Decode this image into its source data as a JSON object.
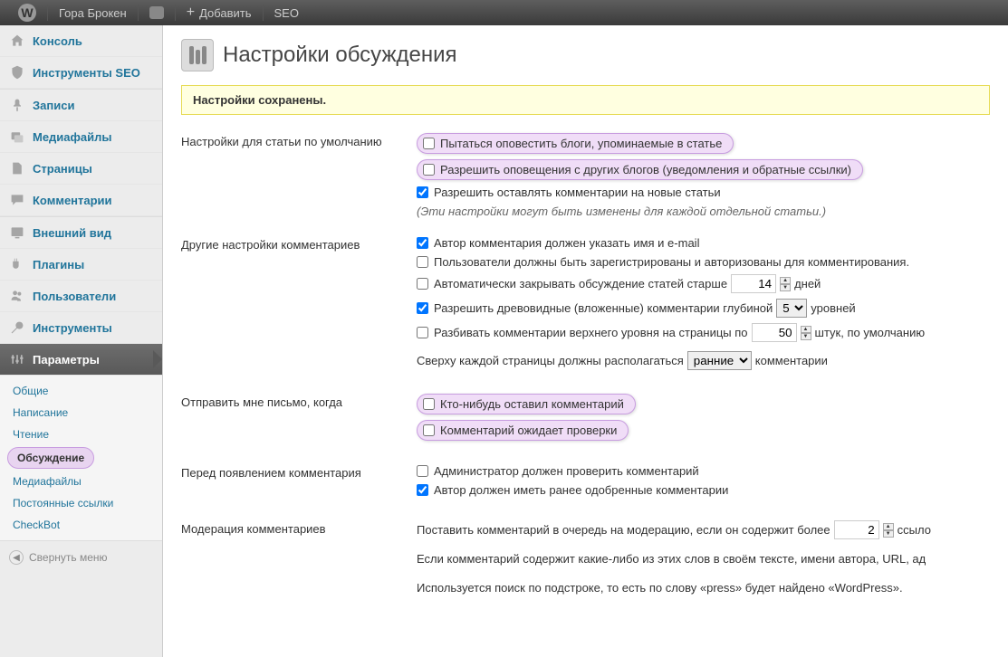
{
  "topbar": {
    "site_name": "Гора Брокен",
    "add_new": "Добавить",
    "seo": "SEO"
  },
  "sidebar": {
    "console": "Консоль",
    "seo_tools": "Инструменты SEO",
    "posts": "Записи",
    "media": "Медиафайлы",
    "pages": "Страницы",
    "comments": "Комментарии",
    "appearance": "Внешний вид",
    "plugins": "Плагины",
    "users": "Пользователи",
    "tools": "Инструменты",
    "settings": "Параметры",
    "submenu": {
      "general": "Общие",
      "writing": "Написание",
      "reading": "Чтение",
      "discussion": "Обсуждение",
      "media": "Медиафайлы",
      "permalinks": "Постоянные ссылки",
      "checkbot": "CheckBot"
    },
    "collapse": "Свернуть меню"
  },
  "page": {
    "title": "Настройки обсуждения",
    "notice": "Настройки сохранены."
  },
  "sections": {
    "default_article": {
      "label": "Настройки для статьи по умолчанию",
      "opt1": "Пытаться оповестить блоги, упоминаемые в статье",
      "opt2": "Разрешить оповещения с других блогов (уведомления и обратные ссылки)",
      "opt3": "Разрешить оставлять комментарии на новые статьи",
      "note": "(Эти настройки могут быть изменены для каждой отдельной статьи.)"
    },
    "other_comments": {
      "label": "Другие настройки комментариев",
      "opt1": "Автор комментария должен указать имя и e-mail",
      "opt2": "Пользователи должны быть зарегистрированы и авторизованы для комментирования.",
      "opt3_pre": "Автоматически закрывать обсуждение статей старше",
      "opt3_days_value": "14",
      "opt3_post": "дней",
      "opt4_pre": "Разрешить древовидные (вложенные) комментарии глубиной",
      "opt4_levels_value": "5",
      "opt4_post": "уровней",
      "opt5_pre": "Разбивать комментарии верхнего уровня на страницы по",
      "opt5_perpage_value": "50",
      "opt5_mid": "штук, по умолчанию",
      "opt6_pre": "Сверху каждой страницы должны располагаться",
      "opt6_select_value": "ранние",
      "opt6_post": "комментарии"
    },
    "email_me": {
      "label": "Отправить мне письмо, когда",
      "opt1": "Кто-нибудь оставил комментарий",
      "opt2": "Комментарий ожидает проверки"
    },
    "before_appear": {
      "label": "Перед появлением комментария",
      "opt1": "Администратор должен проверить комментарий",
      "opt2": "Автор должен иметь ранее одобренные комментарии"
    },
    "moderation": {
      "label": "Модерация комментариев",
      "para1_pre": "Поставить комментарий в очередь на модерацию, если он содержит более",
      "para1_value": "2",
      "para1_post": "ссыло",
      "para2": "Если комментарий содержит какие-либо из этих слов в своём тексте, имени автора, URL, ад",
      "para3": "Используется поиск по подстроке, то есть по слову «press» будет найдено «WordPress»."
    }
  }
}
